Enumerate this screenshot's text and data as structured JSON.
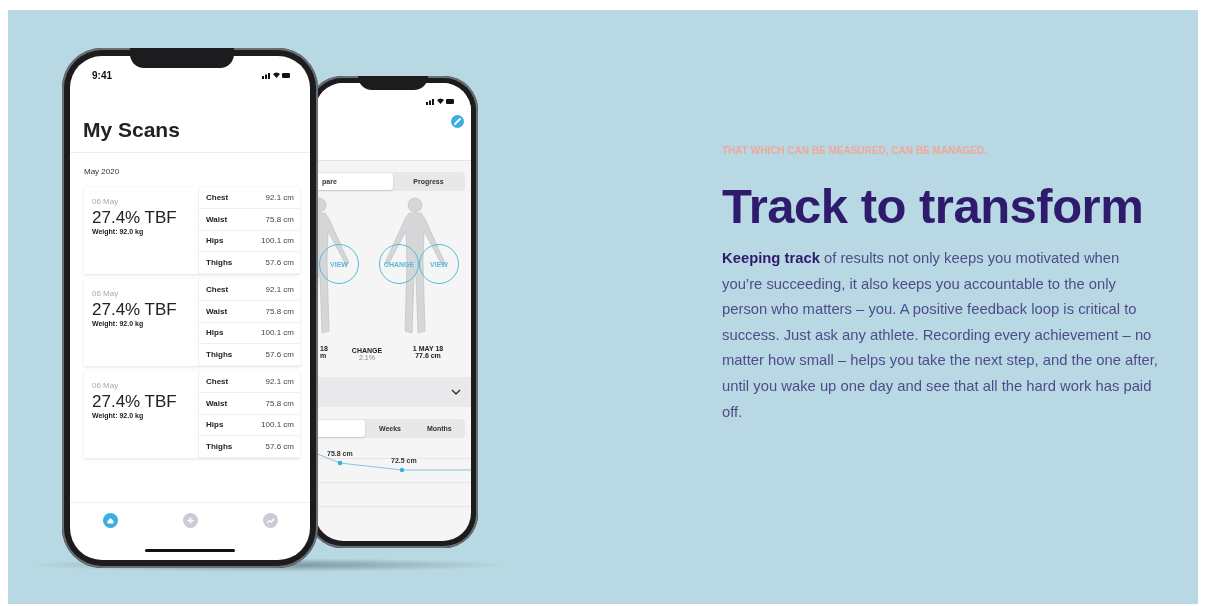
{
  "mockup": {
    "front_phone": {
      "status_time": "9:41",
      "title": "My Scans",
      "section": "May 2020",
      "scans": [
        {
          "date": "06 May",
          "tbf": "27.4% TBF",
          "weight": "Weight: 92.0 kg",
          "measurements": [
            {
              "name": "Chest",
              "value": "92.1 cm"
            },
            {
              "name": "Waist",
              "value": "75.8 cm"
            },
            {
              "name": "Hips",
              "value": "100.1 cm"
            },
            {
              "name": "Thighs",
              "value": "57.6 cm"
            }
          ]
        },
        {
          "date": "06 May",
          "tbf": "27.4% TBF",
          "weight": "Weight: 92.0 kg",
          "measurements": [
            {
              "name": "Chest",
              "value": "92.1 cm"
            },
            {
              "name": "Waist",
              "value": "75.8 cm"
            },
            {
              "name": "Hips",
              "value": "100.1 cm"
            },
            {
              "name": "Thighs",
              "value": "57.6 cm"
            }
          ]
        },
        {
          "date": "06 May",
          "tbf": "27.4% TBF",
          "weight": "Weight: 92.0 kg",
          "measurements": [
            {
              "name": "Chest",
              "value": "92.1 cm"
            },
            {
              "name": "Waist",
              "value": "75.8 cm"
            },
            {
              "name": "Hips",
              "value": "100.1 cm"
            },
            {
              "name": "Thighs",
              "value": "57.6 cm"
            }
          ]
        }
      ],
      "tab_bar": [
        {
          "kind": "home",
          "selected": true
        },
        {
          "kind": "add",
          "selected": false
        },
        {
          "kind": "trend",
          "selected": false
        }
      ]
    },
    "back_phone": {
      "segments": [
        {
          "label": "pare",
          "selected": true
        },
        {
          "label": "Progress",
          "selected": false
        }
      ],
      "figure_buttons": [
        {
          "label": "VIEW"
        },
        {
          "label": "CHANGE"
        },
        {
          "label": "VIEW"
        }
      ],
      "compare_labels": [
        {
          "title": "18",
          "value": "m",
          "kind": "date"
        },
        {
          "title": "CHANGE",
          "value": "2.1%",
          "kind": "change"
        },
        {
          "title": "1 MAY 18",
          "value": "77.6 cm",
          "kind": "date"
        }
      ],
      "period_segments": [
        {
          "label": "Weeks",
          "selected": false
        },
        {
          "label": "Months",
          "selected": false
        }
      ],
      "chart_points": [
        {
          "label": "75.8 cm"
        },
        {
          "label": "72.5 cm"
        }
      ]
    }
  },
  "eyebrow": "THAT WHICH CAN BE MEASURED, CAN BE MANAGED.",
  "heading": "Track to transform",
  "body": "**Keeping track** of results not only keeps you motivated when you’re succeeding, it also keeps you accountable to the only person who matters – you. A positive feedback loop is critical to success. Just ask any athlete. Recording every achievement – no matter how small – helps you take the next step, and the one after, until you wake up one day and see that all the hard work has paid off."
}
